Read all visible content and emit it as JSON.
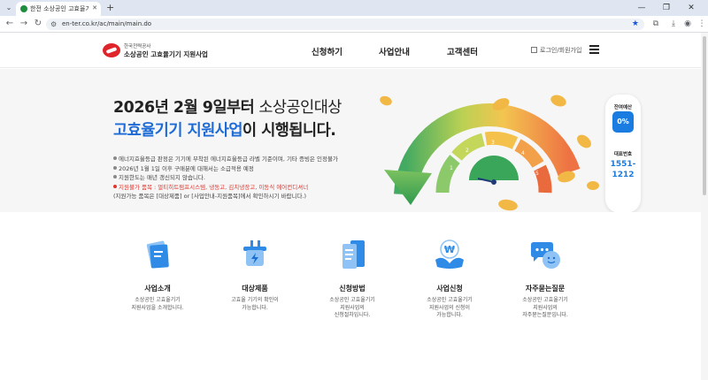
{
  "browser": {
    "tab_title": "한전 소상공인 고효율기기 구!",
    "url": "en-ter.co.kr/ac/main/main.do"
  },
  "header": {
    "logo_small": "한국전력공사",
    "logo_main": "소상공인 고효율기기 지원사업",
    "nav": [
      "신청하기",
      "사업안내",
      "고객센터"
    ],
    "login": "로그인/회원가입"
  },
  "hero": {
    "line1_bold": "2026년 2월 9일부터",
    "line1_rest": " 소상공인대상",
    "line2_blue": "고효율기기 지원사업",
    "line2_rest": "이 시행됩니다.",
    "notes": [
      "에너지효율등급 판정은 기기에 부착된 에너지효율등급 라벨 기준이며, 기타 증빙은 인정불가",
      "2026년 1월 1일 이후 구매분에 대해서는 소급적용 예정",
      "지원한도는 매년 갱신되지 않습니다.",
      "지원불가 품목 : 멀티히트펌프시스템, 냉동고, 김치냉장고, 이동식 에어컨디셔너",
      "(지원가능 품목은 [대상제품] or [사업안내-지원품목]에서 확인하시기 바랍니다.)"
    ],
    "gauge_numbers": [
      "1",
      "2",
      "3",
      "4",
      "5"
    ]
  },
  "side_widget": {
    "budget_label": "잔여예산",
    "budget_value": "0%",
    "phone_label": "대표번호",
    "phone_line1": "1551-",
    "phone_line2": "1212"
  },
  "quick_menu": [
    {
      "title": "사업소개",
      "desc1": "소상공인 고효율기기",
      "desc2": "지원사업을 소개합니다.",
      "desc3": "",
      "icon": "document-stack-icon"
    },
    {
      "title": "대상제품",
      "desc1": "고효율 기기의 확인이",
      "desc2": "가능합니다.",
      "desc3": "",
      "icon": "plug-icon"
    },
    {
      "title": "신청방법",
      "desc1": "소상공인 고효율기기",
      "desc2": "지원사업의",
      "desc3": "신청절차입니다.",
      "icon": "clipboard-icon"
    },
    {
      "title": "사업신청",
      "desc1": "소상공인 고효율기기",
      "desc2": "지원사업의 신청이",
      "desc3": "가능합니다.",
      "icon": "won-hand-icon"
    },
    {
      "title": "자주묻는질문",
      "desc1": "소상공인 고효율기기",
      "desc2": "지원사업의",
      "desc3": "자주묻는질문입니다.",
      "icon": "chat-bubble-icon"
    }
  ],
  "colors": {
    "brand_red": "#e0242b",
    "accent_blue": "#1f6bd6",
    "notice_red": "#e2352c"
  }
}
